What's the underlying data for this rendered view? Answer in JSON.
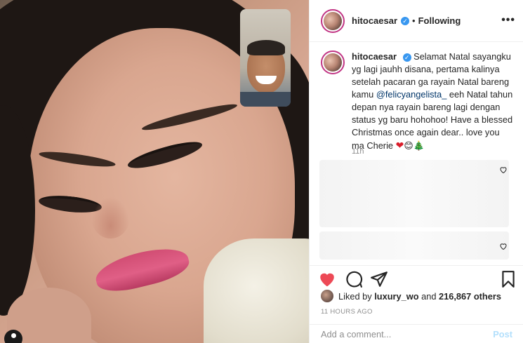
{
  "header": {
    "username": "hitocaesar",
    "separator": "•",
    "follow_status": "Following",
    "more_label": "•••"
  },
  "caption": {
    "username": "hitocaesar",
    "text_before_mention": "Selamat Natal sayangku yg lagi jauhh disana, pertama kalinya setelah pacaran ga rayain Natal bareng kamu",
    "mention": "@felicyangelista_",
    "text_after_mention": "eeh Natal tahun depan nya rayain bareng lagi dengan status yg baru hohohoo! Have a blessed Christmas once again dear.. love you ma Cherie",
    "emojis": [
      "❤",
      "😊",
      "🎄"
    ],
    "time": "11h"
  },
  "comments": [
    {
      "like_icon": "heart-outline-icon"
    },
    {
      "like_icon": "heart-outline-icon"
    }
  ],
  "actions": {
    "like_icon": "heart-filled-icon",
    "comment_icon": "comment-bubble-icon",
    "share_icon": "share-paperplane-icon",
    "save_icon": "bookmark-icon"
  },
  "likes": {
    "prefix": "Liked by",
    "user": "luxury_wo",
    "connector": "and",
    "count": "216,867 others"
  },
  "timestamp": "11 HOURS AGO",
  "add_comment": {
    "placeholder": "Add a comment...",
    "post_label": "Post"
  },
  "colors": {
    "like_red": "#ed4956",
    "verified_blue": "#3897f0",
    "mention": "#003569",
    "post_disabled": "#b2dffc"
  }
}
